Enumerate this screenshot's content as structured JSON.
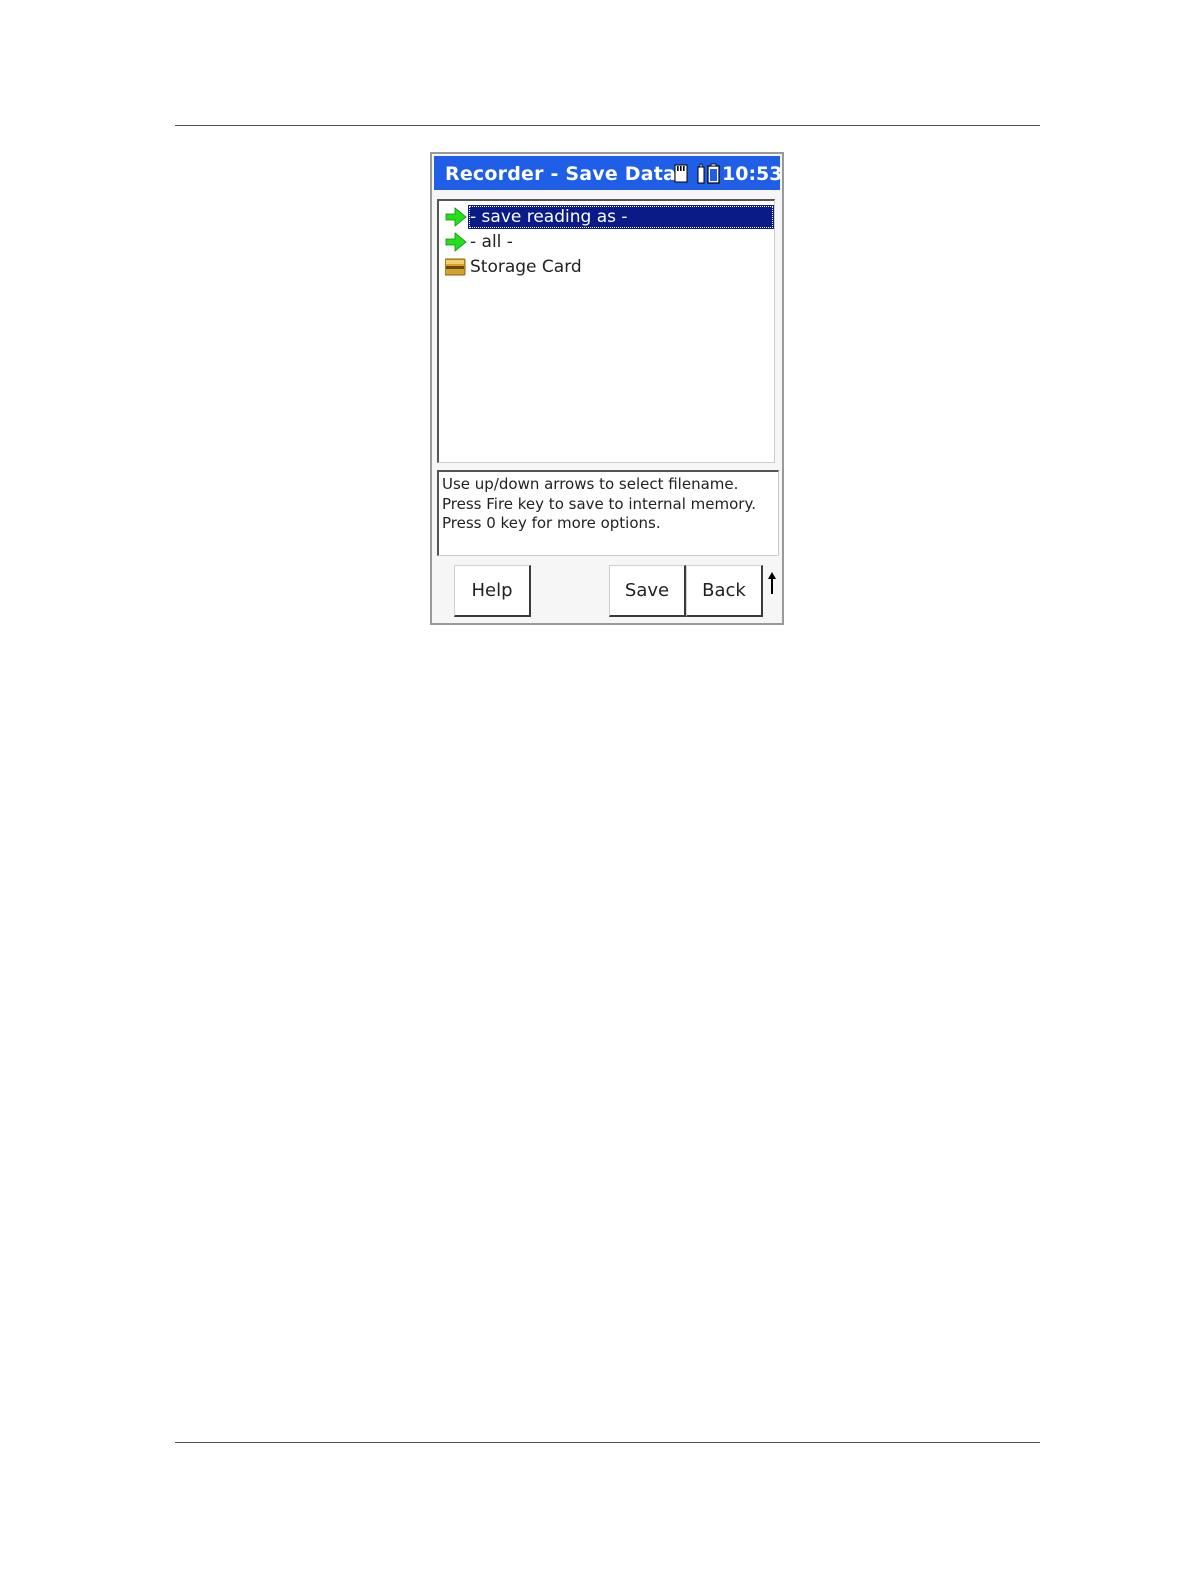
{
  "window": {
    "title": "Recorder - Save Data",
    "clock": "10:53",
    "status_icons": [
      "sd-card-icon",
      "battery-icon"
    ]
  },
  "file_list": {
    "items": [
      {
        "label": "- save reading as -",
        "icon": "green-arrow-icon",
        "selected": true
      },
      {
        "label": "- all -",
        "icon": "green-arrow-icon",
        "selected": false
      },
      {
        "label": "Storage Card",
        "icon": "storage-card-icon",
        "selected": false
      }
    ]
  },
  "help_text": {
    "lines": [
      "Use up/down arrows to select filename.",
      "Press Fire key to save to internal memory.",
      "Press 0 key for more options."
    ]
  },
  "softkeys": {
    "help_label": "Help",
    "save_label": "Save",
    "back_label": "Back",
    "scroll_icon": "up-arrow-icon"
  },
  "colors": {
    "titlebar": "#1f5ee6",
    "selection": "#0a1a86",
    "arrow": "#22e01a"
  }
}
